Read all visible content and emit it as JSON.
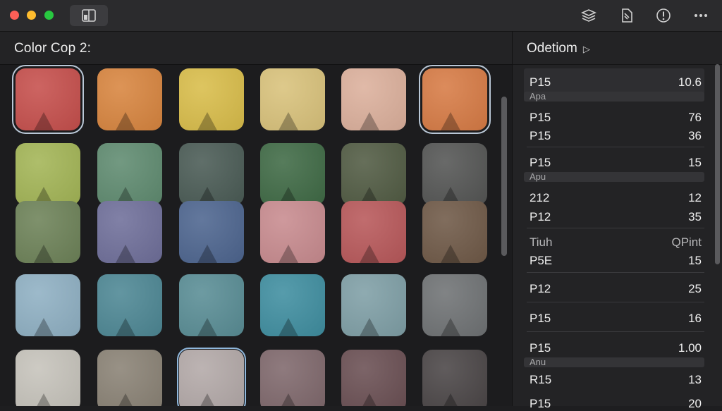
{
  "toolbar": {
    "icons": [
      "sidebar-toggle-icon",
      "layers-icon",
      "document-icon",
      "alert-icon",
      "more-icon"
    ]
  },
  "left_panel": {
    "title": "Color Cop 2:",
    "swatches": [
      [
        "#c64f4c",
        "#d8853f",
        "#d9bd4a",
        "#d9c27b",
        "#dcb09c",
        "#d77b45"
      ],
      [
        "#a3b556",
        "#5f8b70",
        "#4a5b55",
        "#3f6a45",
        "#515b43",
        "#545554"
      ],
      [
        "#6d8258",
        "#6f6f9a",
        "#4d658f",
        "#c88b8f",
        "#b8585a",
        "#6f5947"
      ],
      [
        "#8fb0c3",
        "#4d8794",
        "#598d95",
        "#3f8ea0",
        "#7f9fa6",
        "#6f7274"
      ],
      [
        "#c6c3bb",
        "#8a8275",
        "#b3a9a8",
        "#7f686c",
        "#6a4f53",
        "#4a4546"
      ]
    ]
  },
  "right_panel": {
    "title": "Odetiom",
    "chevron": "▷",
    "rows": [
      {
        "key": "P15",
        "value": "10.6"
      },
      {
        "sub": "Apa"
      },
      {
        "key": "P15",
        "value": "76"
      },
      {
        "key": "P15",
        "value": "36"
      },
      {
        "key": "P15",
        "value": "15"
      },
      {
        "sub": "Apu"
      },
      {
        "key": "212",
        "value": "12"
      },
      {
        "key": "P12",
        "value": "35"
      },
      {
        "key": "Tiuh",
        "value": "QPint"
      },
      {
        "key": "P5E",
        "value": "15"
      },
      {
        "key": "P12",
        "value": "25"
      },
      {
        "key": "P15",
        "value": "16"
      },
      {
        "key": "P15",
        "value": "1.00"
      },
      {
        "sub": "Anu"
      },
      {
        "key": "R15",
        "value": "13"
      },
      {
        "key": "P15",
        "value": "20"
      }
    ]
  }
}
